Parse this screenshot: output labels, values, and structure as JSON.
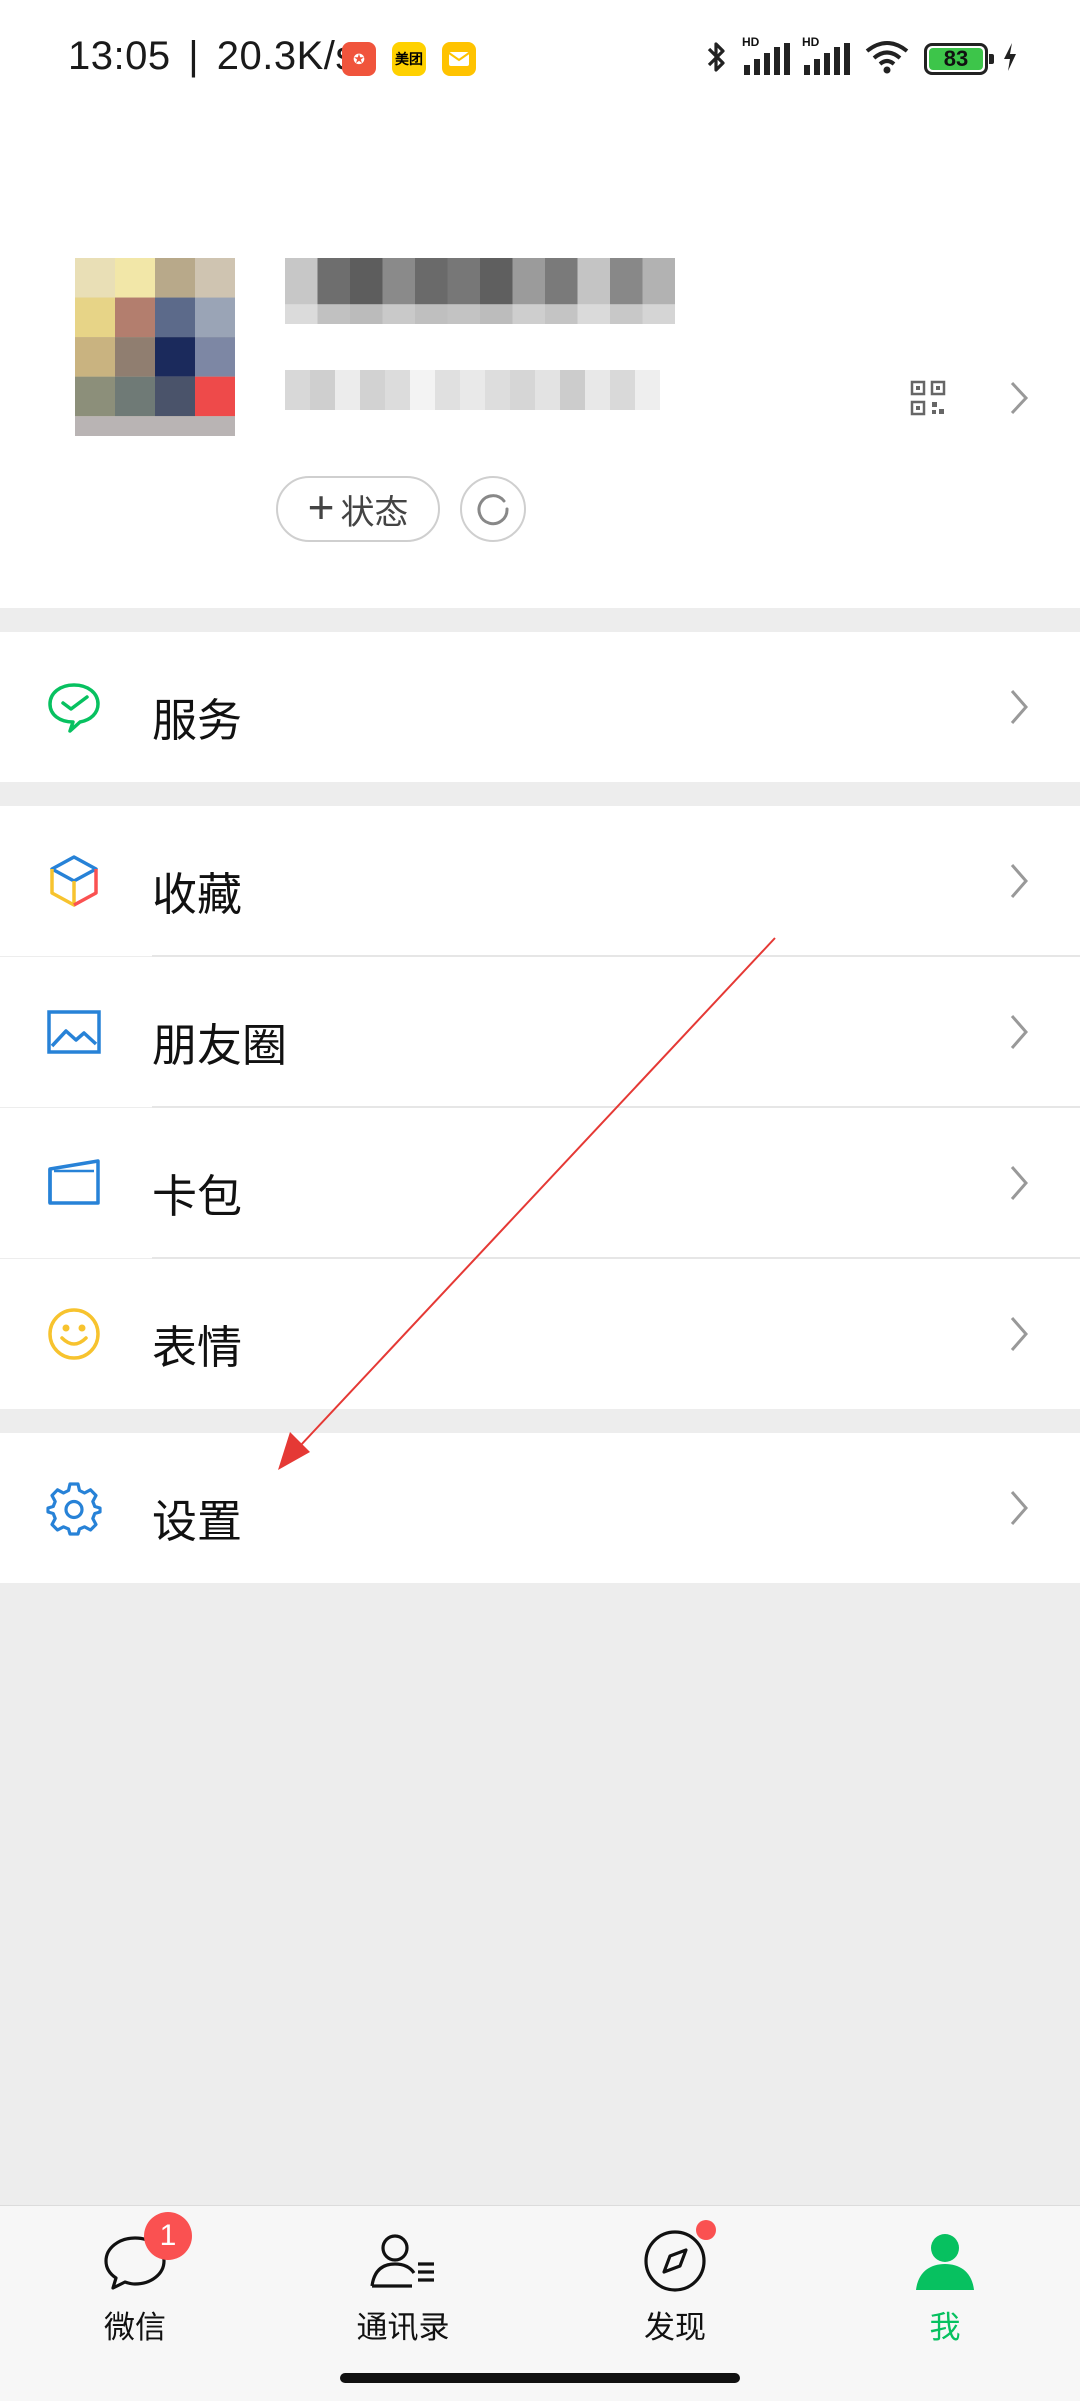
{
  "status_bar": {
    "time": "13:05",
    "separator": "|",
    "net_speed": "20.3K/s",
    "app_badges": [
      {
        "icon": "game-app-icon",
        "color": "#f0543c",
        "text": ""
      },
      {
        "icon": "meituan-app-icon",
        "color": "#ffd100",
        "text": "美团"
      },
      {
        "icon": "mail-app-icon",
        "color": "#ffc300",
        "text": ""
      }
    ],
    "signal_hd_1": "HD",
    "signal_hd_2": "HD",
    "battery_level": "83",
    "colors": {
      "battery": "#3dc54a"
    }
  },
  "profile": {
    "status_label": "状态"
  },
  "menu": {
    "services": {
      "label": "服务",
      "icon": "wechat-pay-icon",
      "color": "#07c160"
    },
    "favorites": {
      "label": "收藏",
      "icon": "cube-icon"
    },
    "moments": {
      "label": "朋友圈",
      "icon": "picture-icon",
      "color": "#2782d7"
    },
    "cards": {
      "label": "卡包",
      "icon": "wallet-icon",
      "color": "#2782d7"
    },
    "stickers": {
      "label": "表情",
      "icon": "smiley-icon",
      "color": "#f7c32e"
    },
    "settings": {
      "label": "设置",
      "icon": "gear-icon",
      "color": "#2782d7"
    }
  },
  "tabs": [
    {
      "label": "微信",
      "icon": "chat-bubble-icon",
      "badge": "1",
      "active": false
    },
    {
      "label": "通讯录",
      "icon": "contacts-icon",
      "active": false
    },
    {
      "label": "发现",
      "icon": "compass-icon",
      "dot": true,
      "active": false
    },
    {
      "label": "我",
      "icon": "person-icon",
      "active": true
    }
  ],
  "colors": {
    "accent": "#07c160",
    "badge": "#fa5151",
    "annotation": "#e53935"
  }
}
